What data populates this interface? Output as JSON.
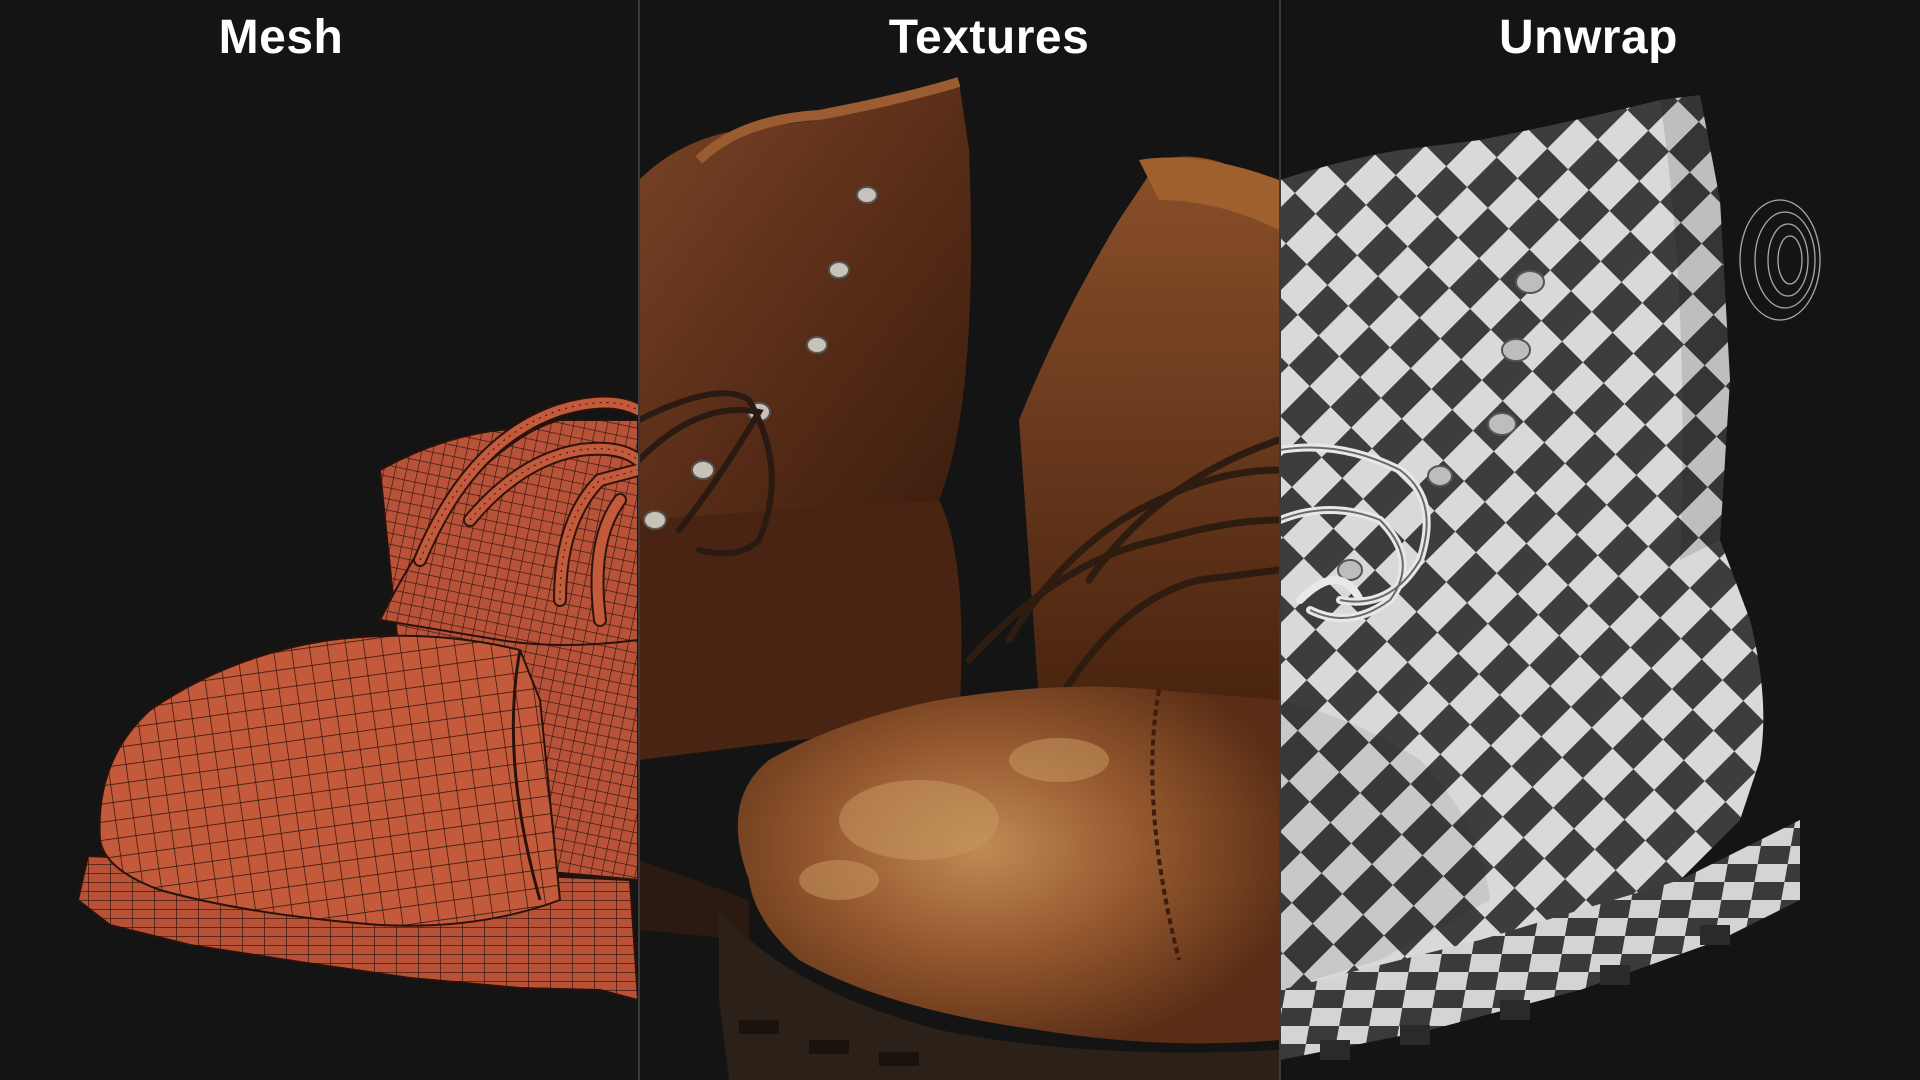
{
  "panels": [
    {
      "title": "Mesh",
      "content": "wireframe-boot",
      "color": "#c45a3a"
    },
    {
      "title": "Textures",
      "content": "textured-leather-boots",
      "color": "#6b3a1f"
    },
    {
      "title": "Unwrap",
      "content": "checker-uv-boot",
      "color": "#3a3a3a"
    }
  ],
  "background_color": "#141414",
  "divider_color": "#3a3a3a"
}
